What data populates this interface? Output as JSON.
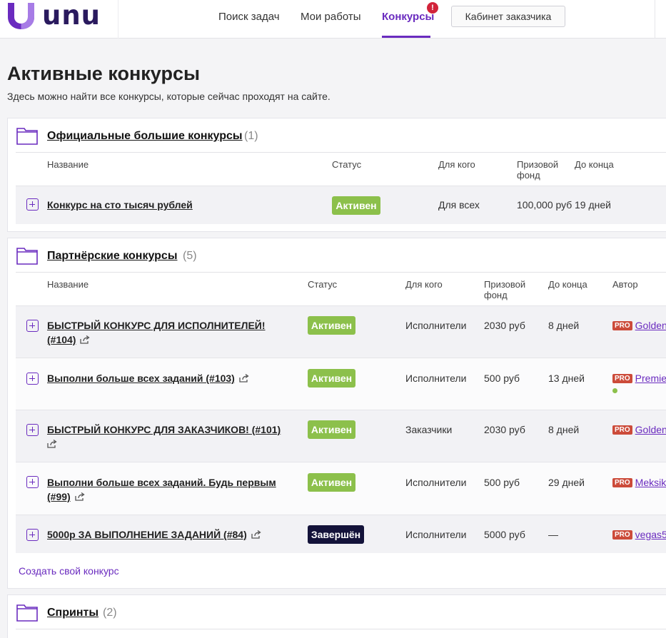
{
  "header": {
    "logo_text": "unu",
    "nav": [
      "Поиск задач",
      "Мои работы",
      "Конкурсы"
    ],
    "nav_badge": "!",
    "cabinet_button": "Кабинет заказчика",
    "brand_color": "#6a2bbf"
  },
  "page": {
    "title": "Активные конкурсы",
    "subtitle": "Здесь можно найти все конкурсы, которые сейчас проходят на сайте."
  },
  "official": {
    "title": "Официальные большие конкурсы",
    "count": "(1)",
    "columns": [
      "Название",
      "Статус",
      "Для кого",
      "Призовой фонд",
      "До конца"
    ],
    "rows": [
      {
        "name": "Конкурс на сто тысяч рублей",
        "status": "Активен",
        "audience": "Для всех",
        "prize": "100,000 руб",
        "ends": "19 дней"
      }
    ]
  },
  "partner": {
    "title": "Партнёрские конкурсы",
    "count": "(5)",
    "columns": [
      "Название",
      "Статус",
      "Для кого",
      "Призовой фонд",
      "До конца",
      "Автор"
    ],
    "rows": [
      {
        "name_line1": "БЫСТРЫЙ КОНКУРС ДЛЯ ИСПОЛНИТЕЛЕЙ!",
        "name_line2": "(#104)",
        "status": "Активен",
        "audience": "Исполнители",
        "prize": "2030 руб",
        "ends": "8 дней",
        "pro": "PRO",
        "author": "Golden"
      },
      {
        "name_line1": "Выполни больше всех заданий (#103)",
        "name_line2": "",
        "status": "Активен",
        "audience": "Исполнители",
        "prize": "500 руб",
        "ends": "13 дней",
        "pro": "PRO",
        "author": "Premie"
      },
      {
        "name_line1": "БЫСТРЫЙ КОНКУРС ДЛЯ ЗАКАЗЧИКОВ! (#101)",
        "name_line2": "",
        "status": "Активен",
        "audience": "Заказчики",
        "prize": "2030 руб",
        "ends": "8 дней",
        "pro": "PRO",
        "author": "Golden"
      },
      {
        "name_line1": "Выполни больше всех заданий. Будь первым",
        "name_line2": "(#99)",
        "status": "Активен",
        "audience": "Исполнители",
        "prize": "500 руб",
        "ends": "29 дней",
        "pro": "PRO",
        "author": "Meksik"
      },
      {
        "name_line1": "5000р ЗА ВЫПОЛНЕНИЕ ЗАДАНИЙ (#84)",
        "name_line2": "",
        "status": "Завершён",
        "audience": "Исполнители",
        "prize": "5000 руб",
        "ends": "—",
        "pro": "PRO",
        "author": "vegas5"
      }
    ],
    "create_link": "Создать свой конкурс"
  },
  "sprints": {
    "title": "Спринты",
    "count": "(2)"
  }
}
